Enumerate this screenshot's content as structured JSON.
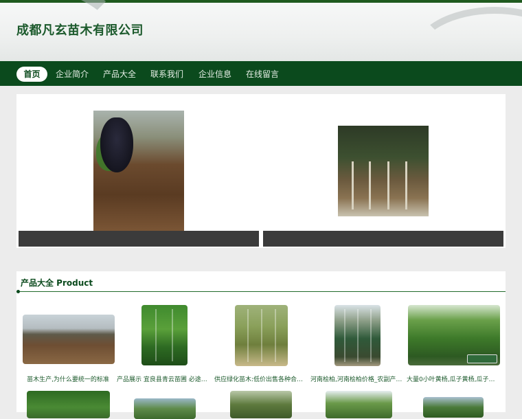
{
  "header": {
    "company_name": "成都凡玄苗木有限公司"
  },
  "nav": {
    "items": [
      {
        "label": "首页",
        "active": true
      },
      {
        "label": "企业简介",
        "active": false
      },
      {
        "label": "产品大全",
        "active": false
      },
      {
        "label": "联系我们",
        "active": false
      },
      {
        "label": "企业信息",
        "active": false
      },
      {
        "label": "在线留言",
        "active": false
      }
    ]
  },
  "slider": {
    "slides": [
      {
        "image": "grape-seedling-photo"
      },
      {
        "image": "sapling-bundle-photo"
      }
    ]
  },
  "products": {
    "section_title": "产品大全 Product",
    "items": [
      {
        "label": "苗木生产,为什么要统一的标准",
        "image": "orchard-field-photo"
      },
      {
        "label": "产品展示 宜良县青云苗圃 必途推荐",
        "image": "green-saplings-photo"
      },
      {
        "label": "供应绿化苗木:低价出售各种合欢...",
        "image": "tree-row-photo"
      },
      {
        "label": "河南桧柏,河南桧柏价格_农副产品...",
        "image": "juniper-rows-photo"
      },
      {
        "label": "大量0小叶黄杨,瓜子黄杨,瓜子黄杨...",
        "image": "boxwood-nursery-photo"
      },
      {
        "label": "",
        "image": "tree-photo"
      },
      {
        "label": "",
        "image": "field-photo"
      },
      {
        "label": "",
        "image": "tree-photo"
      },
      {
        "label": "",
        "image": "tree-photo"
      },
      {
        "label": "",
        "image": "field-photo"
      }
    ]
  },
  "colors": {
    "brand_green": "#0b4a1d",
    "title_green": "#1c5a2c",
    "caption_bar": "#3b3b3b",
    "page_bg": "#ececec"
  }
}
